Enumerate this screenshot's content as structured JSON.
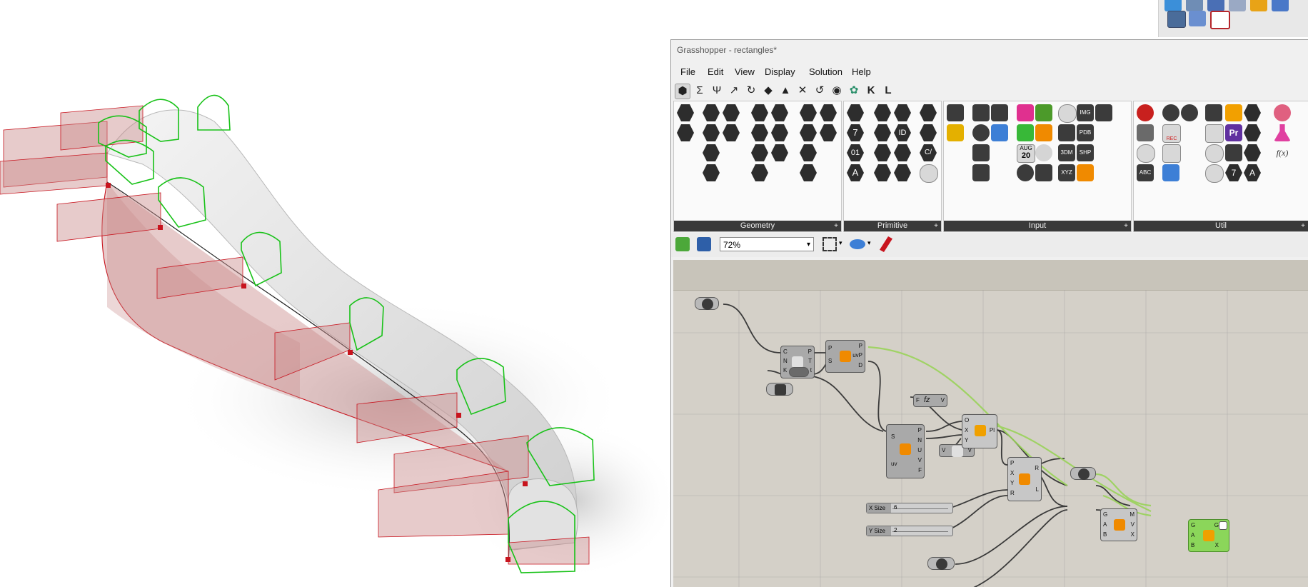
{
  "gh_window": {
    "title": "Grasshopper - rectangles*"
  },
  "menu": {
    "items": [
      "File",
      "Edit",
      "View",
      "Display",
      "Solution",
      "Help"
    ]
  },
  "tabs": {
    "icons": [
      "params-icon",
      "maths-icon",
      "sets-icon",
      "vector-icon",
      "curve-icon",
      "surface-icon",
      "mesh-icon",
      "intersect-icon",
      "transform-icon",
      "display-icon",
      "rhino-icon",
      "kangaroo-icon"
    ],
    "letters": {
      "k": "K",
      "l": "L"
    }
  },
  "ribbon": {
    "geometry": {
      "label": "Geometry"
    },
    "primitive": {
      "label": "Primitive",
      "number_glyph": "7",
      "binary_glyph": "01",
      "id_glyph": "ID",
      "sign_glyph": "C/",
      "a_glyph": "A"
    },
    "input": {
      "label": "Input",
      "img_glyph": "IMG",
      "pdb_glyph": "PDB",
      "shp_glyph": "SHP",
      "three_dm_glyph": "3DM",
      "xyz_glyph": "XYZ",
      "number_twenty": "20",
      "aug_glyph": "AUG"
    },
    "util": {
      "label": "Util",
      "rec_glyph": "REC",
      "abc_glyph": "ABC",
      "fx_glyph": "f(x)",
      "pr_glyph": "Pr",
      "seven_glyph": "7",
      "a_glyph": "A"
    },
    "expand_glyph": "+"
  },
  "canvas_toolbar": {
    "zoom": "72%"
  },
  "components": {
    "crv_ports": {
      "in": [
        "C",
        "N",
        "K"
      ],
      "out": [
        "P",
        "T",
        "t"
      ]
    },
    "eval_ports": {
      "in": [
        "P",
        "S"
      ],
      "out": [
        "P",
        "uvP",
        "D"
      ]
    },
    "fz": {
      "in": "F",
      "label": "fz",
      "out": "V"
    },
    "srf_ports": {
      "in": [
        "S",
        "uv"
      ],
      "out": [
        "P",
        "N",
        "U",
        "V",
        "F"
      ]
    },
    "vec": {
      "in": "V",
      "out": "V"
    },
    "plane_ports": {
      "in": [
        "O",
        "X",
        "Y"
      ],
      "out": [
        "Pl"
      ]
    },
    "rect_ports": {
      "in": [
        "P",
        "X",
        "Y",
        "R"
      ],
      "out": [
        "R",
        "L"
      ]
    },
    "swp_ports": {
      "in": [
        "G",
        "A",
        "B"
      ],
      "out": [
        "M",
        "V",
        "X"
      ]
    },
    "green_ports": {
      "in": [
        "G",
        "A",
        "B"
      ],
      "out": [
        "G",
        "X"
      ]
    },
    "x_slider": {
      "label": "X Size",
      "value": "6"
    },
    "y_slider": {
      "label": "Y Size",
      "value": "2"
    }
  },
  "colors": {
    "profile": "#18c218",
    "plane_fill": "#c98c8c",
    "red": "#c8141e",
    "canvas": "#d4d0c8",
    "wire_selected": "#9ad35a",
    "component": "#a9a9a9",
    "output_component": "#8bd65a"
  }
}
